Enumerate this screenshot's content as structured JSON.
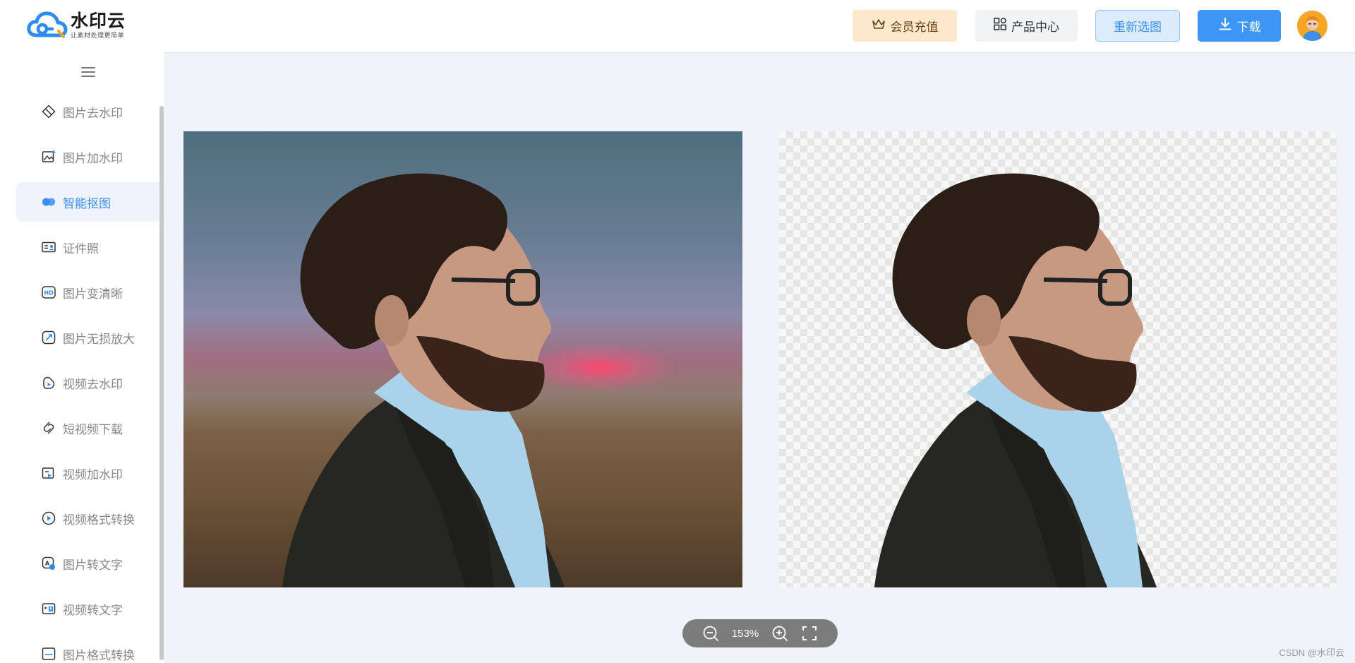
{
  "app": {
    "name": "水印云",
    "slogan": "让素材处理更简单"
  },
  "header": {
    "vip_label": "会员充值",
    "products_label": "产品中心",
    "reselect_label": "重新选图",
    "download_label": "下载",
    "brand_color": "#3d96f5"
  },
  "sidebar": {
    "active_index": 2,
    "items": [
      {
        "label": "图片去水印",
        "icon": "eraser-icon"
      },
      {
        "label": "图片加水印",
        "icon": "image-add-icon"
      },
      {
        "label": "智能抠图",
        "icon": "cutout-icon"
      },
      {
        "label": "证件照",
        "icon": "id-card-icon"
      },
      {
        "label": "图片变清晰",
        "icon": "hd-icon"
      },
      {
        "label": "图片无损放大",
        "icon": "enlarge-icon"
      },
      {
        "label": "视频去水印",
        "icon": "video-eraser-icon"
      },
      {
        "label": "短视频下载",
        "icon": "link-icon"
      },
      {
        "label": "视频加水印",
        "icon": "video-add-icon"
      },
      {
        "label": "视频格式转换",
        "icon": "play-circle-icon"
      },
      {
        "label": "图片转文字",
        "icon": "image-text-icon"
      },
      {
        "label": "视频转文字",
        "icon": "video-text-icon"
      },
      {
        "label": "图片格式转换",
        "icon": "image-format-icon"
      }
    ]
  },
  "viewer": {
    "zoom": "153%"
  },
  "footer": {
    "watermark": "CSDN @水印云"
  }
}
